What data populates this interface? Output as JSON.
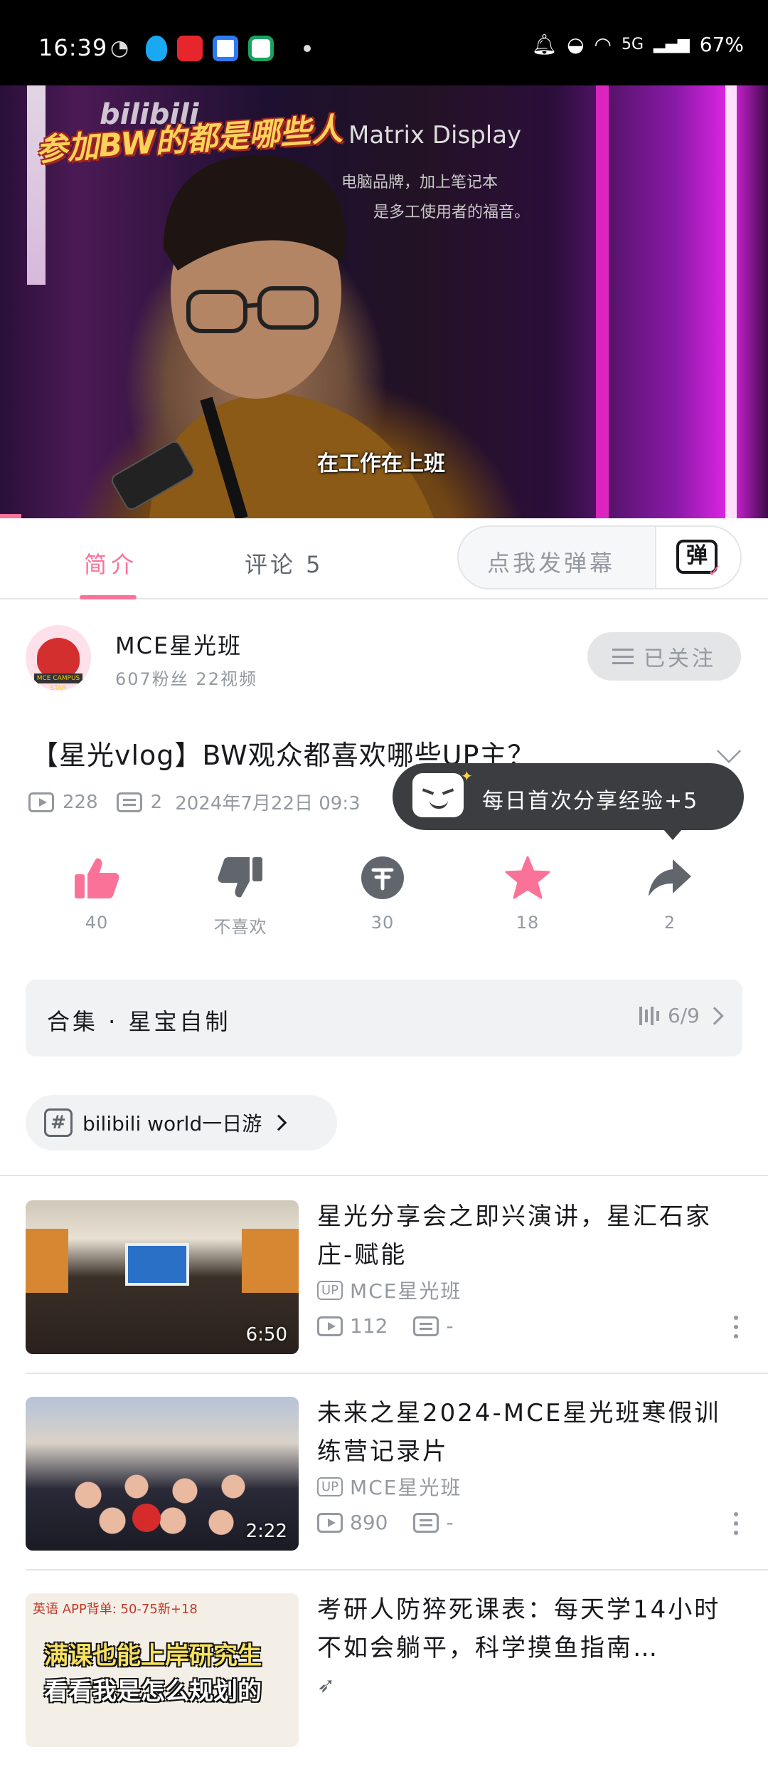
{
  "status_bar": {
    "time": "16:39",
    "battery": "67%",
    "network": "5G"
  },
  "video": {
    "overlay_title": "参加BW的都是哪些人",
    "brand": "bilibili",
    "background_text": [
      "Matrix Display",
      "电脑品牌，加上笔记本",
      "是多工使用者的福音。"
    ],
    "caption": "在工作在上班"
  },
  "tabs": [
    {
      "label": "简介",
      "active": true
    },
    {
      "label": "评论 5",
      "active": false
    }
  ],
  "danmaku": {
    "placeholder": "点我发弹幕",
    "button": "弹"
  },
  "author": {
    "name": "MCE星光班",
    "stats": "607粉丝  22视频",
    "follow_label": "已关注",
    "avatar_tag": "MCE CAMPUS STAR"
  },
  "video_info": {
    "title": "【星光vlog】BW观众都喜欢哪些UP主？",
    "views": "228",
    "danmaku_count": "2",
    "date": "2024年7月22日 09:3"
  },
  "tooltip": {
    "text": "每日首次分享经验+5"
  },
  "actions": [
    {
      "name": "like",
      "count": "40"
    },
    {
      "name": "dislike",
      "count": "不喜欢"
    },
    {
      "name": "coin",
      "count": "30"
    },
    {
      "name": "favorite",
      "count": "18"
    },
    {
      "name": "share",
      "count": "2"
    }
  ],
  "collection": {
    "label": "合集 · 星宝自制",
    "progress": "6/9"
  },
  "topic": {
    "label": "bilibili world一日游"
  },
  "related": [
    {
      "title": "星光分享会之即兴演讲，星汇石家庄-赋能",
      "up": "MCE星光班",
      "views": "112",
      "danmaku": "-",
      "duration": "6:50"
    },
    {
      "title": "未来之星2024-MCE星光班寒假训练营记录片",
      "up": "MCE星光班",
      "views": "890",
      "danmaku": "-",
      "duration": "2:22"
    },
    {
      "title": "考研人防猝死课表：每天学14小时不如会躺平，科学摸鱼指南…",
      "up": "",
      "views": "",
      "danmaku": "",
      "duration": ""
    }
  ],
  "thumb3_text": {
    "line1": "满课也能上岸研究生",
    "line2": "看看我是怎么规划的",
    "scribble": "英语 APP背单: 50-75新+18"
  },
  "colors": {
    "accent": "#fb7299",
    "text": "#18191c",
    "muted": "#9499a0"
  }
}
